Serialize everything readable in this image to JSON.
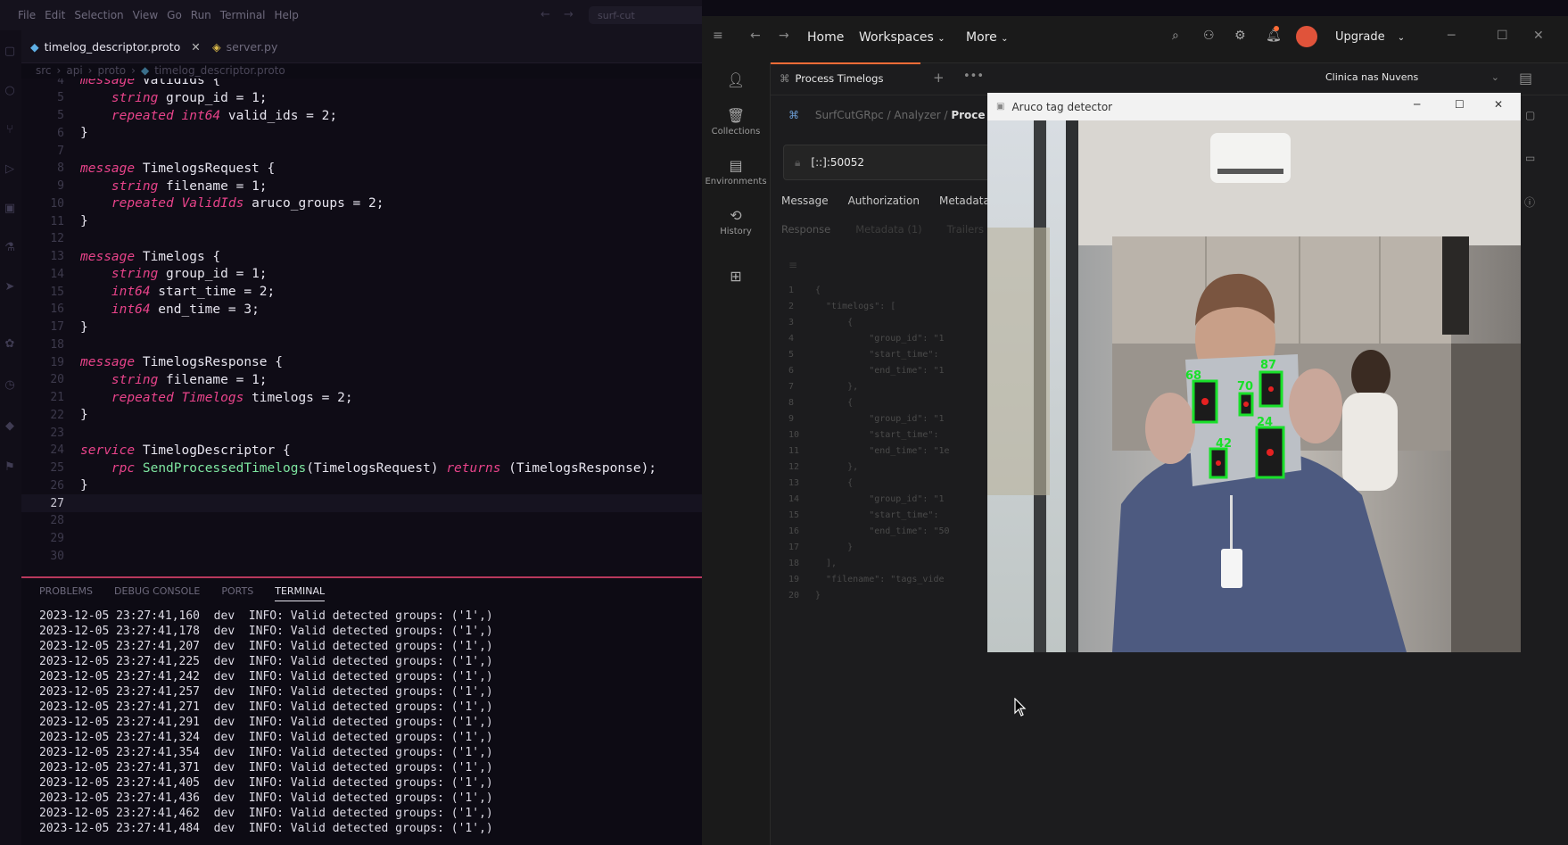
{
  "vscode": {
    "menu": [
      "File",
      "Edit",
      "Selection",
      "View",
      "Go",
      "Run",
      "Terminal",
      "Help"
    ],
    "search_text": "surf-cut",
    "tabs": [
      {
        "label": "timelog_descriptor.proto",
        "active": true
      },
      {
        "label": "server.py",
        "active": false
      }
    ],
    "breadcrumb": [
      "src",
      "api",
      "proto",
      "timelog_descriptor.proto"
    ],
    "code_lines": [
      {
        "n": "4",
        "parts": [
          [
            "kw",
            "message"
          ],
          [
            "nm",
            " ValidIds {"
          ]
        ]
      },
      {
        "n": "5",
        "parts": [
          [
            "nm",
            "    "
          ],
          [
            "ty",
            "string"
          ],
          [
            "nm",
            " group_id = 1;"
          ]
        ]
      },
      {
        "n": "5",
        "parts": [
          [
            "nm",
            "    "
          ],
          [
            "ty",
            "repeated"
          ],
          [
            "nm",
            " "
          ],
          [
            "ty",
            "int64"
          ],
          [
            "nm",
            " valid_ids = 2;"
          ]
        ]
      },
      {
        "n": "6",
        "parts": [
          [
            "nm",
            "}"
          ]
        ]
      },
      {
        "n": "7",
        "parts": []
      },
      {
        "n": "8",
        "parts": [
          [
            "kw",
            "message"
          ],
          [
            "nm",
            " TimelogsRequest {"
          ]
        ]
      },
      {
        "n": "9",
        "parts": [
          [
            "nm",
            "    "
          ],
          [
            "ty",
            "string"
          ],
          [
            "nm",
            " filename = 1;"
          ]
        ]
      },
      {
        "n": "10",
        "parts": [
          [
            "nm",
            "    "
          ],
          [
            "ty",
            "repeated"
          ],
          [
            "nm",
            " "
          ],
          [
            "ty",
            "ValidIds"
          ],
          [
            "nm",
            " aruco_groups = 2;"
          ]
        ]
      },
      {
        "n": "11",
        "parts": [
          [
            "nm",
            "}"
          ]
        ]
      },
      {
        "n": "12",
        "parts": []
      },
      {
        "n": "13",
        "parts": [
          [
            "kw",
            "message"
          ],
          [
            "nm",
            " Timelogs {"
          ]
        ]
      },
      {
        "n": "14",
        "parts": [
          [
            "nm",
            "    "
          ],
          [
            "ty",
            "string"
          ],
          [
            "nm",
            " group_id = 1;"
          ]
        ]
      },
      {
        "n": "15",
        "parts": [
          [
            "nm",
            "    "
          ],
          [
            "ty",
            "int64"
          ],
          [
            "nm",
            " start_time = 2;"
          ]
        ]
      },
      {
        "n": "16",
        "parts": [
          [
            "nm",
            "    "
          ],
          [
            "ty",
            "int64"
          ],
          [
            "nm",
            " end_time = 3;"
          ]
        ]
      },
      {
        "n": "17",
        "parts": [
          [
            "nm",
            "}"
          ]
        ]
      },
      {
        "n": "18",
        "parts": []
      },
      {
        "n": "19",
        "parts": [
          [
            "kw",
            "message"
          ],
          [
            "nm",
            " TimelogsResponse {"
          ]
        ]
      },
      {
        "n": "20",
        "parts": [
          [
            "nm",
            "    "
          ],
          [
            "ty",
            "string"
          ],
          [
            "nm",
            " filename = 1;"
          ]
        ]
      },
      {
        "n": "21",
        "parts": [
          [
            "nm",
            "    "
          ],
          [
            "ty",
            "repeated"
          ],
          [
            "nm",
            " "
          ],
          [
            "ty",
            "Timelogs"
          ],
          [
            "nm",
            " timelogs = 2;"
          ]
        ]
      },
      {
        "n": "22",
        "parts": [
          [
            "nm",
            "}"
          ]
        ]
      },
      {
        "n": "23",
        "parts": []
      },
      {
        "n": "24",
        "parts": [
          [
            "kw",
            "service"
          ],
          [
            "nm",
            " TimelogDescriptor {"
          ]
        ]
      },
      {
        "n": "25",
        "parts": [
          [
            "nm",
            "    "
          ],
          [
            "kw",
            "rpc"
          ],
          [
            "nm",
            " "
          ],
          [
            "fn",
            "SendProcessedTimelogs"
          ],
          [
            "nm",
            "(TimelogsRequest) "
          ],
          [
            "kw",
            "returns"
          ],
          [
            "nm",
            " (TimelogsResponse);"
          ]
        ]
      },
      {
        "n": "26",
        "parts": [
          [
            "nm",
            "}"
          ]
        ]
      },
      {
        "n": "27",
        "parts": [],
        "current": true
      },
      {
        "n": "28",
        "parts": []
      },
      {
        "n": "29",
        "parts": []
      },
      {
        "n": "30",
        "parts": []
      }
    ],
    "panel_tabs": [
      "PROBLEMS",
      "DEBUG CONSOLE",
      "PORTS",
      "TERMINAL"
    ],
    "terminal_lines": [
      "2023-12-05 23:27:41,160  dev  INFO: Valid detected groups: ('1',)",
      "2023-12-05 23:27:41,178  dev  INFO: Valid detected groups: ('1',)",
      "2023-12-05 23:27:41,207  dev  INFO: Valid detected groups: ('1',)",
      "2023-12-05 23:27:41,225  dev  INFO: Valid detected groups: ('1',)",
      "2023-12-05 23:27:41,242  dev  INFO: Valid detected groups: ('1',)",
      "2023-12-05 23:27:41,257  dev  INFO: Valid detected groups: ('1',)",
      "2023-12-05 23:27:41,271  dev  INFO: Valid detected groups: ('1',)",
      "2023-12-05 23:27:41,291  dev  INFO: Valid detected groups: ('1',)",
      "2023-12-05 23:27:41,324  dev  INFO: Valid detected groups: ('1',)",
      "2023-12-05 23:27:41,354  dev  INFO: Valid detected groups: ('1',)",
      "2023-12-05 23:27:41,371  dev  INFO: Valid detected groups: ('1',)",
      "2023-12-05 23:27:41,405  dev  INFO: Valid detected groups: ('1',)",
      "2023-12-05 23:27:41,436  dev  INFO: Valid detected groups: ('1',)",
      "2023-12-05 23:27:41,462  dev  INFO: Valid detected groups: ('1',)",
      "2023-12-05 23:27:41,484  dev  INFO: Valid detected groups: ('1',)"
    ]
  },
  "postman": {
    "nav": {
      "home": "Home",
      "workspaces": "Workspaces",
      "more": "More",
      "upgrade": "Upgrade"
    },
    "sidebar": [
      "Collections",
      "Environments",
      "History"
    ],
    "request_tab": "Process Timelogs",
    "workspace_name": "Clinica nas Nuvens",
    "breadcrumb": [
      "SurfCutGRpc",
      "Analyzer",
      "Proce"
    ],
    "url": "[::]:50052",
    "request_tabs": [
      "Message",
      "Authorization",
      "Metadata"
    ],
    "response_tabs": [
      "Response",
      "Metadata (1)",
      "Trailers"
    ],
    "response_body": [
      "{",
      "  \"timelogs\": [",
      "      {",
      "          \"group_id\": \"1",
      "          \"start_time\":",
      "          \"end_time\": \"1",
      "      },",
      "      {",
      "          \"group_id\": \"1",
      "          \"start_time\":",
      "          \"end_time\": \"1e",
      "      },",
      "      {",
      "          \"group_id\": \"1",
      "          \"start_time\":",
      "          \"end_time\": \"50",
      "      }",
      "  ],",
      "  \"filename\": \"tags_vide",
      "}"
    ]
  },
  "aruco_window": {
    "title": "Aruco tag detector",
    "marker_ids": [
      "68",
      "87",
      "70",
      "24",
      "42"
    ]
  }
}
